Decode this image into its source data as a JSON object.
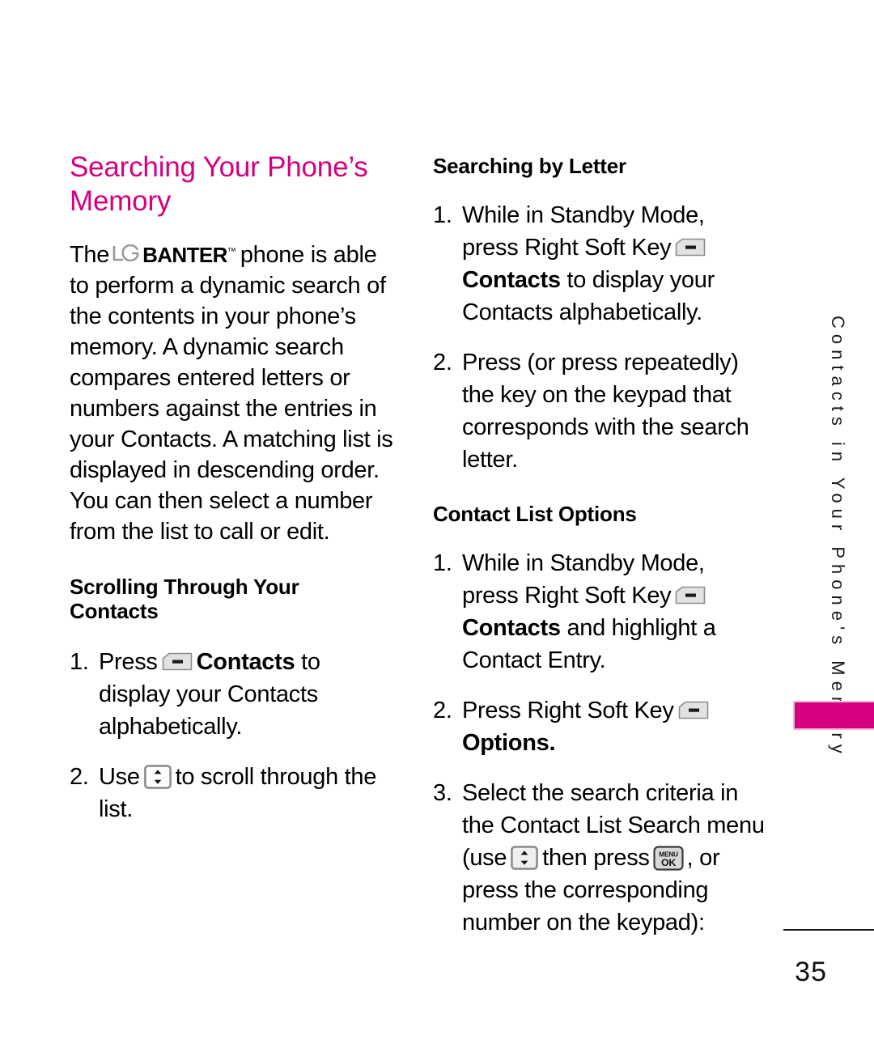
{
  "page": {
    "number": "35",
    "side_tab": "Contacts in Your Phone's Memory",
    "accent_color": "#D6007F"
  },
  "left_column": {
    "title": "Searching Your Phone’s Memory",
    "intro": {
      "before_logo": "The",
      "logo_lg": "LG",
      "logo_banter": "BANTER",
      "logo_tm": "™",
      "after_logo": "phone is able to perform a dynamic search of the contents in your phone’s memory. A dynamic search compares entered letters or numbers against the entries in your Contacts. A matching list is displayed in descending order. You can then select a number from the list to call or edit."
    },
    "section": {
      "heading": "Scrolling Through Your Contacts",
      "steps": [
        {
          "number": "1.",
          "part1": "Press",
          "icon": "soft-key-icon",
          "part2_bold": "Contacts",
          "part3": "to display your Contacts alphabetically."
        },
        {
          "number": "2.",
          "part1": "Use",
          "icon": "navigation-up-down-key-icon",
          "part2": "to scroll through the list."
        }
      ]
    }
  },
  "right_column": {
    "section_a": {
      "heading": "Searching by Letter",
      "steps": [
        {
          "number": "1.",
          "part1": "While in Standby Mode, press Right Soft Key",
          "icon": "soft-key-icon",
          "part2_bold": "Contacts",
          "part3": "to display your Contacts alphabetically."
        },
        {
          "number": "2.",
          "text": "Press (or press repeatedly) the key on the keypad that corresponds with the search letter."
        }
      ]
    },
    "section_b": {
      "heading": "Contact List Options",
      "steps": [
        {
          "number": "1.",
          "part1": "While in Standby Mode, press Right Soft Key",
          "icon": "soft-key-icon",
          "part2_bold": "Contacts",
          "part3": "and highlight a Contact Entry."
        },
        {
          "number": "2.",
          "part1": "Press Right Soft Key",
          "icon": "soft-key-icon",
          "part2_bold": "Options",
          "part3": "."
        },
        {
          "number": "3.",
          "part1": "Select the search criteria in the Contact List Search menu (use",
          "icon1": "navigation-up-down-key-icon",
          "part2": "then press",
          "icon2": "menu-ok-key-icon",
          "part3": ", or press the corresponding number on the keypad):"
        }
      ]
    }
  },
  "icons": {
    "soft_key": "soft-key-icon",
    "nav_key": "navigation-up-down-key-icon",
    "menu_ok_key_line1": "MENU",
    "menu_ok_key_line2": "OK"
  }
}
